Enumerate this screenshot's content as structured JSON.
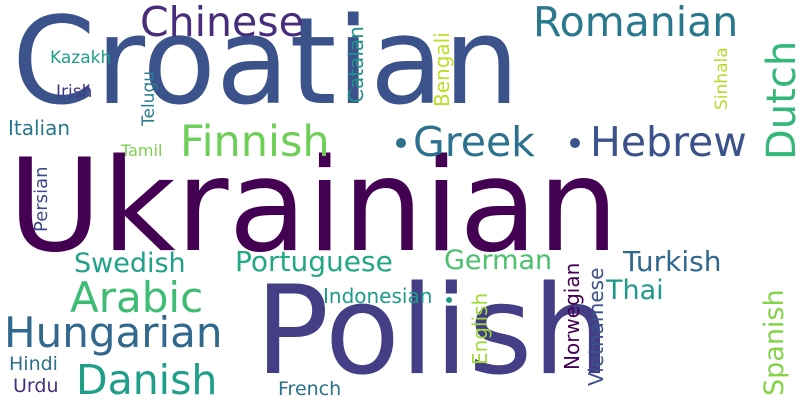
{
  "cloud": {
    "words": [
      {
        "text": "Ukrainian",
        "color": "#440154"
      },
      {
        "text": "Croatian",
        "color": "#3b528b"
      },
      {
        "text": "Polish",
        "color": "#433e85"
      },
      {
        "text": "Chinese",
        "color": "#472d7b"
      },
      {
        "text": "Romanian",
        "color": "#2a788e"
      },
      {
        "text": "Dutch",
        "color": "#35b779"
      },
      {
        "text": "Finnish",
        "color": "#6ece58"
      },
      {
        "text": "Greek",
        "color": "#2c728e"
      },
      {
        "text": "Hebrew",
        "color": "#3b528b"
      },
      {
        "text": "Kazakh",
        "color": "#1f9e89"
      },
      {
        "text": "Irish",
        "color": "#443a83"
      },
      {
        "text": "Telugu",
        "color": "#287d8e"
      },
      {
        "text": "Catalan",
        "color": "#21918c"
      },
      {
        "text": "Bengali",
        "color": "#bddf26"
      },
      {
        "text": "Sinhala",
        "color": "#b5de2b"
      },
      {
        "text": "Italian",
        "color": "#2a788e"
      },
      {
        "text": "Tamil",
        "color": "#7ad151"
      },
      {
        "text": "Persian",
        "color": "#3e4989"
      },
      {
        "text": "Swedish",
        "color": "#1fa187"
      },
      {
        "text": "Portuguese",
        "color": "#22a884"
      },
      {
        "text": "German",
        "color": "#4ac16d"
      },
      {
        "text": "Turkish",
        "color": "#31688e"
      },
      {
        "text": "Thai",
        "color": "#1f9a8a"
      },
      {
        "text": "Arabic",
        "color": "#3dbc74"
      },
      {
        "text": "Indonesian",
        "color": "#1e9b8a"
      },
      {
        "text": "Hungarian",
        "color": "#31688e"
      },
      {
        "text": "English",
        "color": "#a0da39"
      },
      {
        "text": "Norwegian",
        "color": "#440154"
      },
      {
        "text": "Vietnamese",
        "color": "#3b528b"
      },
      {
        "text": "Spanish",
        "color": "#84d44b"
      },
      {
        "text": "Hindi",
        "color": "#2e6f8e"
      },
      {
        "text": "Urdu",
        "color": "#46307e"
      },
      {
        "text": "Danish",
        "color": "#1f9e89"
      },
      {
        "text": "French",
        "color": "#2c728e"
      }
    ]
  }
}
